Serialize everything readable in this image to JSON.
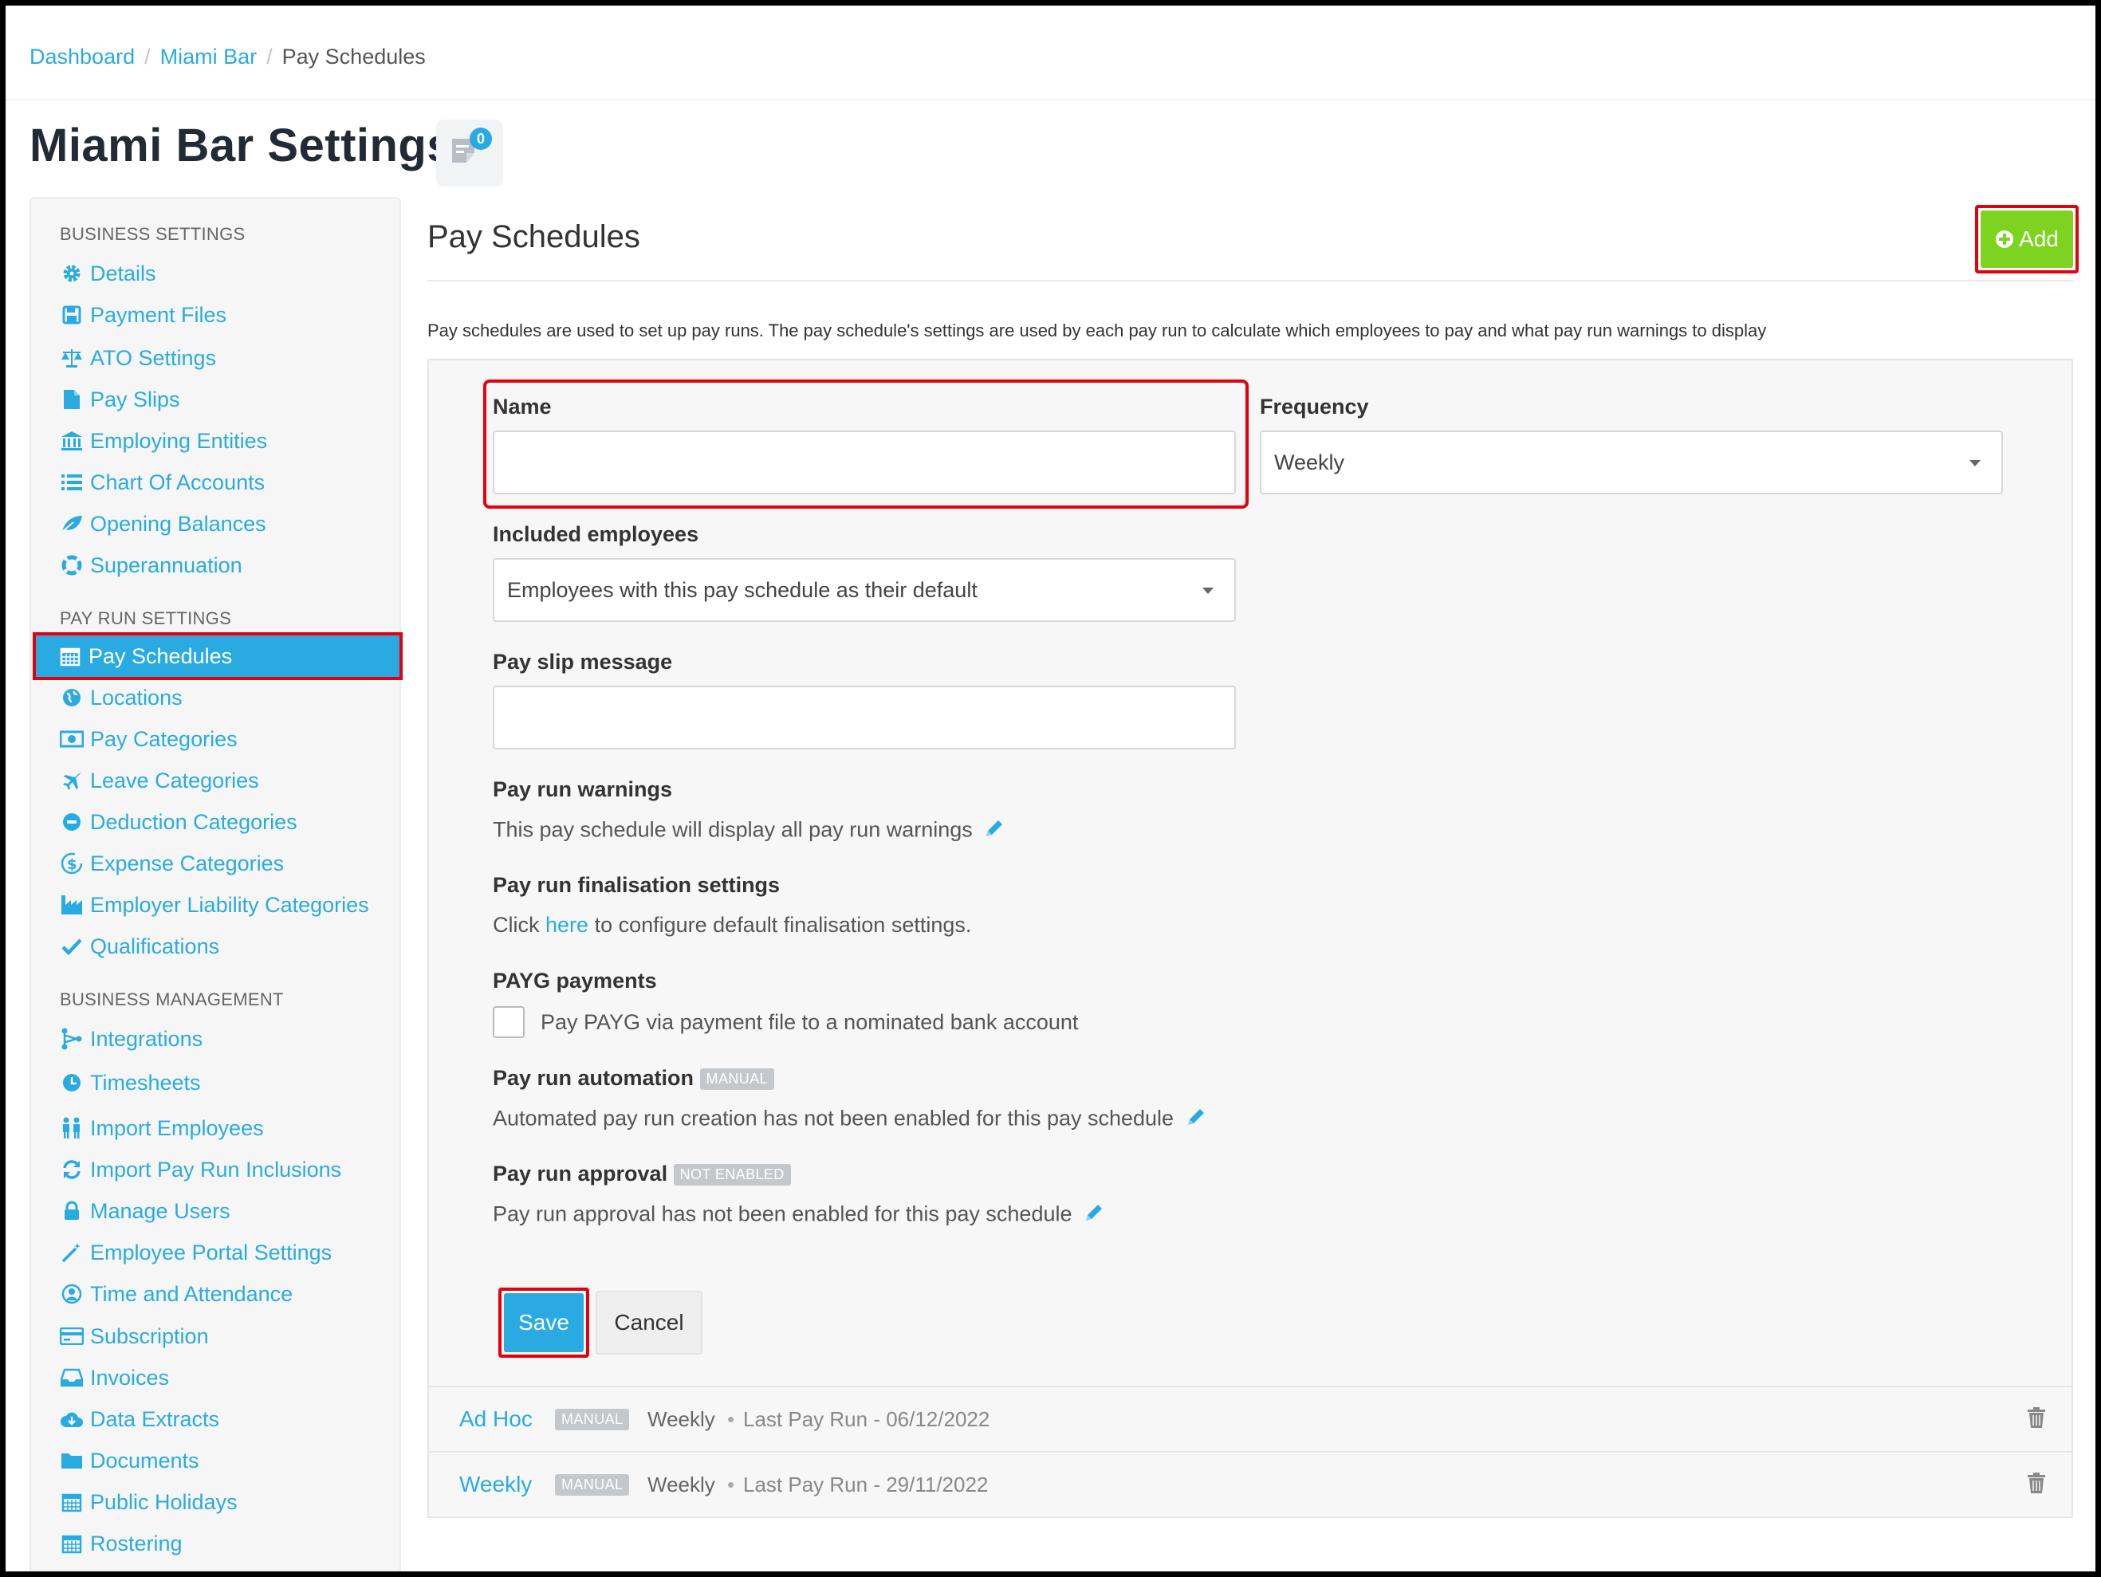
{
  "breadcrumb": {
    "item1": "Dashboard",
    "item2": "Miami Bar",
    "current": "Pay Schedules",
    "separator": "/"
  },
  "page": {
    "title": "Miami Bar Settings",
    "notes_count": "0"
  },
  "sidebar": {
    "business_settings": {
      "heading": "BUSINESS SETTINGS",
      "items": [
        "Details",
        "Payment Files",
        "ATO Settings",
        "Pay Slips",
        "Employing Entities",
        "Chart Of Accounts",
        "Opening Balances",
        "Superannuation"
      ]
    },
    "pay_run_settings": {
      "heading": "PAY RUN SETTINGS",
      "items": [
        "Pay Schedules",
        "Locations",
        "Pay Categories",
        "Leave Categories",
        "Deduction Categories",
        "Expense Categories",
        "Employer Liability Categories",
        "Qualifications"
      ]
    },
    "business_management": {
      "heading": "BUSINESS MANAGEMENT",
      "items": [
        "Integrations",
        "Timesheets",
        "Import Employees",
        "Import Pay Run Inclusions",
        "Manage Users",
        "Employee Portal Settings",
        "Time and Attendance",
        "Subscription",
        "Invoices",
        "Data Extracts",
        "Documents",
        "Public Holidays",
        "Rostering"
      ]
    }
  },
  "main": {
    "section_title": "Pay Schedules",
    "add_label": "Add",
    "intro": "Pay schedules are used to set up pay runs. The pay schedule's settings are used by each pay run to calculate which employees to pay and what pay run warnings to display"
  },
  "form": {
    "name_label": "Name",
    "name_value": "",
    "frequency_label": "Frequency",
    "frequency_value": "Weekly",
    "included_label": "Included employees",
    "included_value": "Employees with this pay schedule as their default",
    "payslip_label": "Pay slip message",
    "payslip_value": "",
    "warnings_label": "Pay run warnings",
    "warnings_text": "This pay schedule will display all pay run warnings",
    "finalisation_label": "Pay run finalisation settings",
    "finalisation_pre": "Click",
    "finalisation_link": "here",
    "finalisation_post": "to configure default finalisation settings.",
    "payg_label": "PAYG payments",
    "payg_checkbox": "Pay PAYG via payment file to a nominated bank account",
    "automation_label": "Pay run automation",
    "automation_badge": "MANUAL",
    "automation_text": "Automated pay run creation has not been enabled for this pay schedule",
    "approval_label": "Pay run approval",
    "approval_badge": "NOT ENABLED",
    "approval_text": "Pay run approval has not been enabled for this pay schedule",
    "save_label": "Save",
    "cancel_label": "Cancel"
  },
  "schedules": [
    {
      "name": "Ad Hoc",
      "badge": "MANUAL",
      "frequency": "Weekly",
      "sep": "•",
      "last_run": "Last Pay Run - 06/12/2022"
    },
    {
      "name": "Weekly",
      "badge": "MANUAL",
      "frequency": "Weekly",
      "sep": "•",
      "last_run": "Last Pay Run - 29/11/2022"
    }
  ],
  "colors": {
    "accent": "#29abe2",
    "add_button": "#7ed321",
    "highlight": "#e3000f",
    "badge": "#c4c7cc"
  }
}
